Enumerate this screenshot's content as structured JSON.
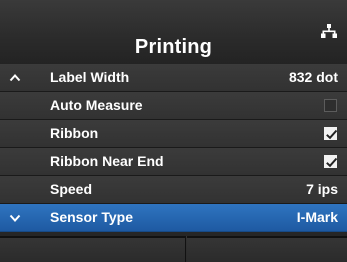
{
  "header": {
    "title": "Printing",
    "network_icon": "network-icon"
  },
  "menu": {
    "items": [
      {
        "label": "Label Width",
        "value": "832 dot",
        "indicator": "chevron-up-icon"
      },
      {
        "label": "Auto Measure",
        "checked": false
      },
      {
        "label": "Ribbon",
        "checked": true
      },
      {
        "label": "Ribbon Near End",
        "checked": true
      },
      {
        "label": "Speed",
        "value": "7 ips"
      },
      {
        "label": "Sensor Type",
        "value": "I-Mark",
        "indicator": "chevron-down-icon",
        "selected": true
      }
    ]
  },
  "colors": {
    "background": "#262626",
    "row": "#363636",
    "selected_row": "#2467b0",
    "text": "#ffffff"
  }
}
